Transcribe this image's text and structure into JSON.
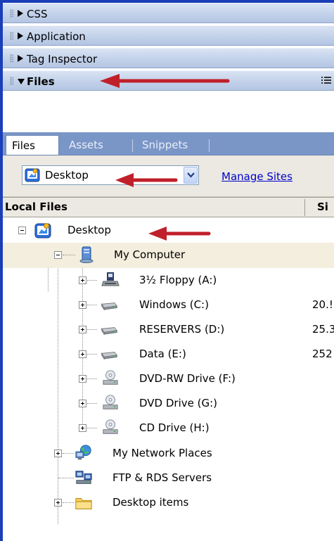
{
  "panels": [
    {
      "label": "CSS",
      "expanded": false
    },
    {
      "label": "Application",
      "expanded": false
    },
    {
      "label": "Tag Inspector",
      "expanded": false
    },
    {
      "label": "Files",
      "expanded": true
    }
  ],
  "tabs": [
    "Files",
    "Assets",
    "Snippets"
  ],
  "active_tab": "Files",
  "site_selector": {
    "value": "Desktop",
    "manage_link": "Manage Sites"
  },
  "columns": {
    "local": "Local Files",
    "size": "Si"
  },
  "tree": [
    {
      "label": "Desktop",
      "icon": "desktop-icon",
      "size": ""
    },
    {
      "label": "My Computer",
      "icon": "computer-icon",
      "size": ""
    },
    {
      "label": "3½ Floppy (A:)",
      "icon": "floppy-drive-icon",
      "size": ""
    },
    {
      "label": "Windows (C:)",
      "icon": "hard-drive-icon",
      "size": "20.!"
    },
    {
      "label": "RESERVERS (D:)",
      "icon": "hard-drive-icon",
      "size": "25.3"
    },
    {
      "label": "Data (E:)",
      "icon": "hard-drive-icon",
      "size": "252"
    },
    {
      "label": "DVD-RW Drive (F:)",
      "icon": "cd-drive-icon",
      "size": ""
    },
    {
      "label": "DVD Drive (G:)",
      "icon": "cd-drive-icon",
      "size": ""
    },
    {
      "label": "CD Drive (H:)",
      "icon": "cd-drive-icon",
      "size": ""
    },
    {
      "label": "My Network Places",
      "icon": "network-places-icon",
      "size": ""
    },
    {
      "label": "FTP & RDS Servers",
      "icon": "ftp-servers-icon",
      "size": ""
    },
    {
      "label": "Desktop items",
      "icon": "folder-icon",
      "size": ""
    }
  ],
  "colors": {
    "frame_border": "#1a3fb8",
    "tab_bar": "#7a96c7",
    "annotation_arrow": "#c0202a",
    "link": "#0000cc"
  }
}
